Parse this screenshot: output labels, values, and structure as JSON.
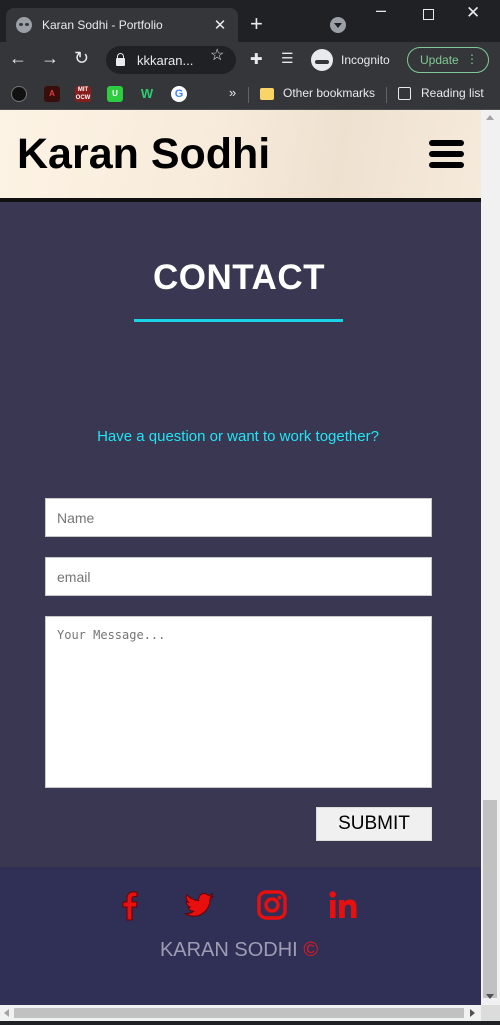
{
  "browser": {
    "tab_title": "Karan Sodhi - Portfolio",
    "url": "kkkaran...",
    "incognito_label": "Incognito",
    "update_label": "Update",
    "bookmarks": {
      "chevron": "»",
      "other_bookmarks": "Other bookmarks",
      "reading_list": "Reading list",
      "favicons": [
        "Roadmap",
        "Anime",
        "MIT OCW",
        "Udemy",
        "Wattpad",
        "Google"
      ]
    }
  },
  "header": {
    "brand": "Karan Sodhi"
  },
  "contact": {
    "title": "CONTACT",
    "tagline": "Have a question or want to work together?",
    "name_placeholder": "Name",
    "email_placeholder": "email",
    "message_placeholder": "Your Message...",
    "submit_label": "SUBMIT"
  },
  "footer": {
    "social": [
      "facebook",
      "twitter",
      "instagram",
      "linkedin"
    ],
    "copyright_name": "KARAN SODHI",
    "copyright_symbol": "©",
    "icon_color": "#e80f0f"
  },
  "colors": {
    "page_background": "#393752",
    "footer_background": "#302f56",
    "accent": "#19d3e6"
  }
}
